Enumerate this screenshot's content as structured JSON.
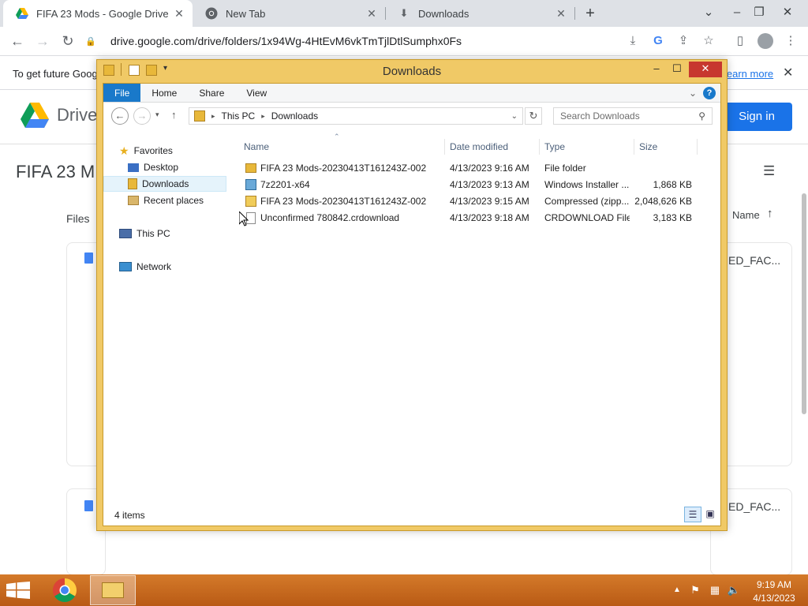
{
  "browser": {
    "tabs": [
      {
        "title": "FIFA 23 Mods - Google Drive",
        "icon": "google-drive-icon",
        "active": true
      },
      {
        "title": "New Tab",
        "icon": "chrome-icon",
        "active": false
      },
      {
        "title": "Downloads",
        "icon": "download-icon",
        "active": false
      }
    ],
    "new_tab": "+",
    "url": "drive.google.com/drive/folders/1x94Wg-4HtEvM6vkTmTjlDtlSumphx0Fs",
    "infobar_text": "To get future Goog",
    "infobar_link": "learn more"
  },
  "drive": {
    "logo_text": "Drive",
    "sign_in": "Sign in",
    "folder_title": "FIFA 23 M",
    "files_label": "Files",
    "sort_label": "Name",
    "card_label_1": "ED_FAC...",
    "card_label_2": "ED_FAC..."
  },
  "explorer": {
    "title": "Downloads",
    "ribbon_tabs": [
      "File",
      "Home",
      "Share",
      "View"
    ],
    "breadcrumb": [
      "This PC",
      "Downloads"
    ],
    "search_placeholder": "Search Downloads",
    "nav": {
      "favorites": "Favorites",
      "desktop": "Desktop",
      "downloads": "Downloads",
      "recent": "Recent places",
      "this_pc": "This PC",
      "network": "Network"
    },
    "columns": {
      "name": "Name",
      "date": "Date modified",
      "type": "Type",
      "size": "Size"
    },
    "files": [
      {
        "name": "FIFA 23 Mods-20230413T161243Z-002",
        "date": "4/13/2023 9:16 AM",
        "type": "File folder",
        "size": "",
        "icon": "folder-icon"
      },
      {
        "name": "7z2201-x64",
        "date": "4/13/2023 9:13 AM",
        "type": "Windows Installer ...",
        "size": "1,868 KB",
        "icon": "installer-icon"
      },
      {
        "name": "FIFA 23 Mods-20230413T161243Z-002",
        "date": "4/13/2023 9:15 AM",
        "type": "Compressed (zipp...",
        "size": "2,048,626 KB",
        "icon": "zip-folder-icon"
      },
      {
        "name": "Unconfirmed 780842.crdownload",
        "date": "4/13/2023 9:18 AM",
        "type": "CRDOWNLOAD File",
        "size": "3,183 KB",
        "icon": "blank-file-icon"
      }
    ],
    "status": "4 items"
  },
  "taskbar": {
    "time": "9:19 AM",
    "date": "4/13/2023"
  }
}
